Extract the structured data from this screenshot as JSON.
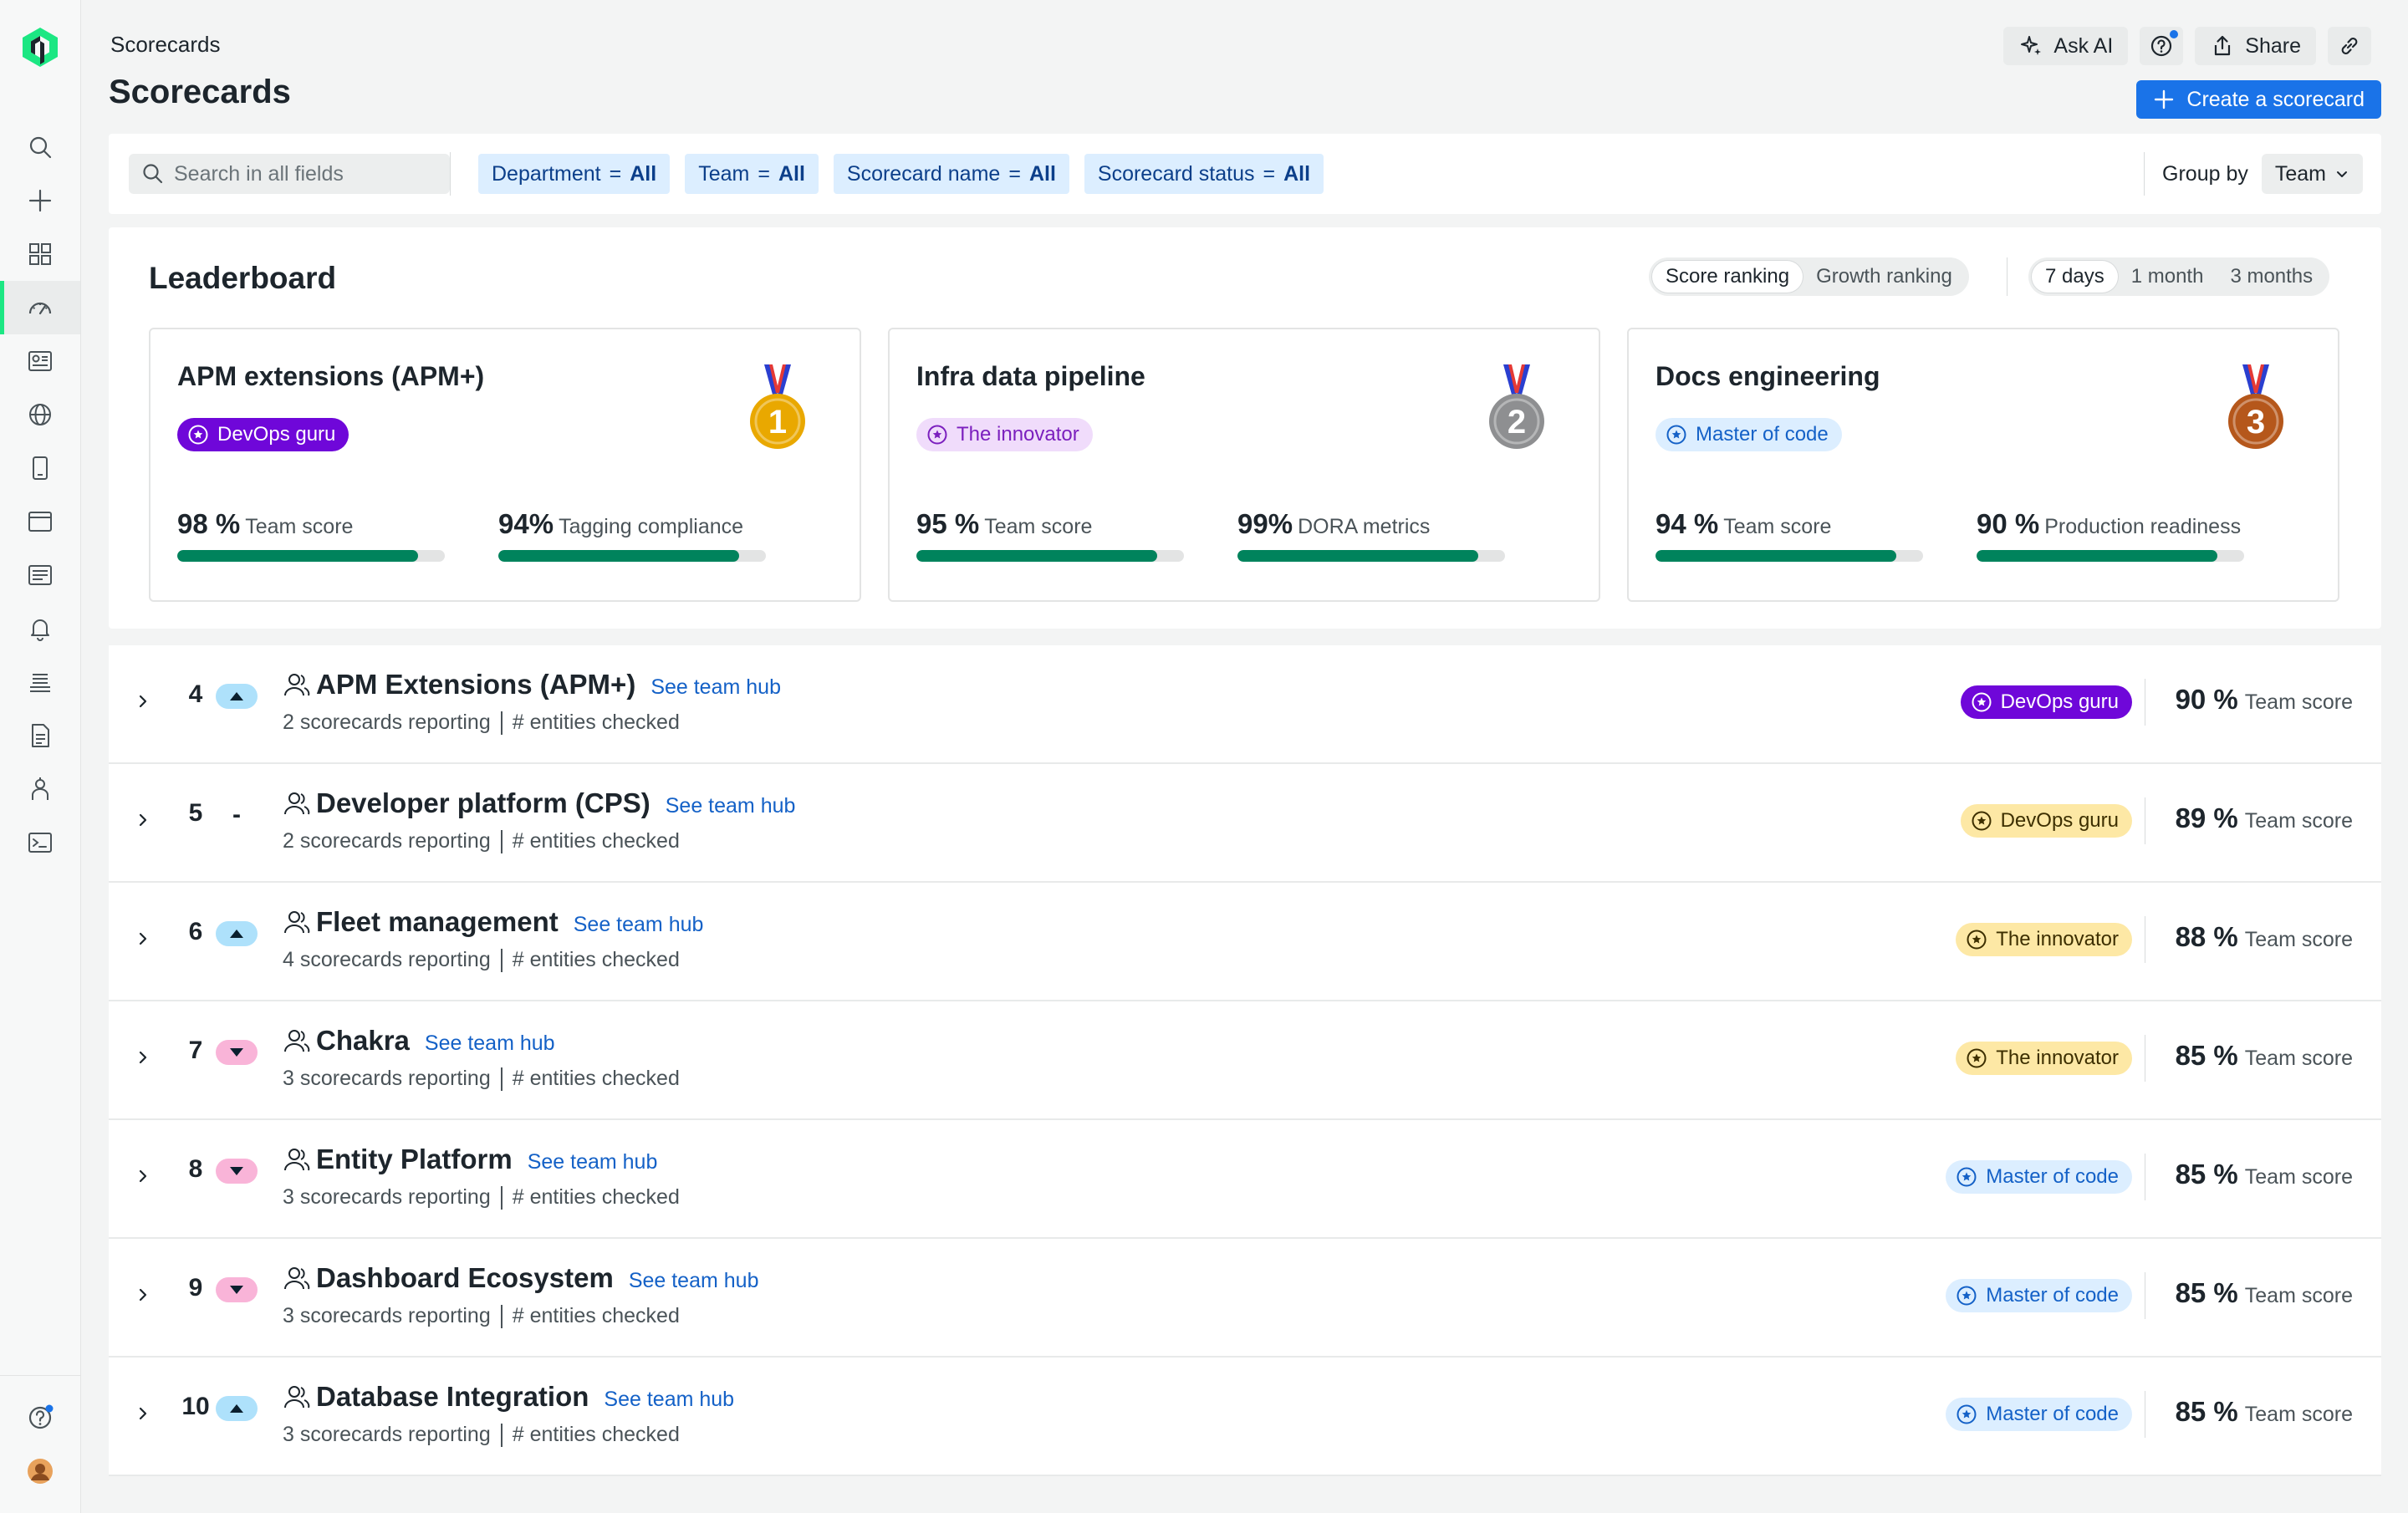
{
  "header": {
    "breadcrumb": "Scorecards",
    "title": "Scorecards",
    "ask_ai": "Ask AI",
    "share": "Share",
    "create": "Create a scorecard"
  },
  "filters": {
    "search_placeholder": "Search in all fields",
    "chips": [
      {
        "key": "Department",
        "op": "=",
        "value": "All"
      },
      {
        "key": "Team",
        "op": "=",
        "value": "All"
      },
      {
        "key": "Scorecard name",
        "op": "=",
        "value": "All"
      },
      {
        "key": "Scorecard status",
        "op": "=",
        "value": "All"
      }
    ],
    "group_by_label": "Group by",
    "group_by_value": "Team"
  },
  "leaderboard": {
    "title": "Leaderboard",
    "ranking_tabs": [
      "Score ranking",
      "Growth ranking"
    ],
    "ranking_selected": "Score ranking",
    "range_tabs": [
      "7 days",
      "1 month",
      "3 months"
    ],
    "range_selected": "7 days",
    "cards": [
      {
        "name": "APM extensions (APM+)",
        "medal": "1",
        "medal_color": "#e9a800",
        "badge": "DevOps guru",
        "badge_style": "purple",
        "metrics": [
          {
            "pct": "98 %",
            "label": "Team score",
            "value": 0.9
          },
          {
            "pct": "94%",
            "label": "Tagging compliance",
            "value": 0.9
          }
        ]
      },
      {
        "name": "Infra data pipeline",
        "medal": "2",
        "medal_color": "#8e8f91",
        "badge": "The innovator",
        "badge_style": "lavender",
        "metrics": [
          {
            "pct": "95 %",
            "label": "Team score",
            "value": 0.9
          },
          {
            "pct": "99%",
            "label": "DORA metrics",
            "value": 0.9
          }
        ]
      },
      {
        "name": "Docs engineering",
        "medal": "3",
        "medal_color": "#b5571b",
        "badge": "Master of code",
        "badge_style": "lightblue",
        "metrics": [
          {
            "pct": "94 %",
            "label": "Team score",
            "value": 0.9
          },
          {
            "pct": "90 %",
            "label": "Production readiness",
            "value": 0.9
          }
        ]
      }
    ]
  },
  "teams": [
    {
      "rank": "4",
      "trend": "up",
      "name": "APM Extensions (APM+)",
      "link": "See team hub",
      "reporting": "2 scorecards reporting",
      "entities": "# entities checked",
      "badge": "DevOps guru",
      "badge_style": "purple",
      "score": "90 %",
      "score_label": "Team score"
    },
    {
      "rank": "5",
      "trend": "flat",
      "trend_text": "-",
      "name": "Developer platform (CPS)",
      "link": "See team hub",
      "reporting": "2 scorecards reporting",
      "entities": "# entities checked",
      "badge": "DevOps guru",
      "badge_style": "yellow",
      "score": "89 %",
      "score_label": "Team score"
    },
    {
      "rank": "6",
      "trend": "up",
      "name": "Fleet management",
      "link": "See team hub",
      "reporting": "4 scorecards reporting",
      "entities": "# entities checked",
      "badge": "The innovator",
      "badge_style": "yellow",
      "score": "88 %",
      "score_label": "Team score"
    },
    {
      "rank": "7",
      "trend": "down",
      "name": "Chakra",
      "link": "See team hub",
      "reporting": "3 scorecards reporting",
      "entities": "# entities checked",
      "badge": "The innovator",
      "badge_style": "yellow",
      "score": "85 %",
      "score_label": "Team score"
    },
    {
      "rank": "8",
      "trend": "down",
      "name": "Entity Platform",
      "link": "See team hub",
      "reporting": "3 scorecards reporting",
      "entities": "# entities checked",
      "badge": "Master of code",
      "badge_style": "lightblue",
      "score": "85 %",
      "score_label": "Team score"
    },
    {
      "rank": "9",
      "trend": "down",
      "name": "Dashboard Ecosystem",
      "link": "See team hub",
      "reporting": "3 scorecards reporting",
      "entities": "# entities checked",
      "badge": "Master of code",
      "badge_style": "lightblue",
      "score": "85 %",
      "score_label": "Team score"
    },
    {
      "rank": "10",
      "trend": "up",
      "name": "Database Integration",
      "link": "See team hub",
      "reporting": "3 scorecards reporting",
      "entities": "# entities checked",
      "badge": "Master of code",
      "badge_style": "lightblue",
      "score": "85 %",
      "score_label": "Team score"
    }
  ],
  "sidebar": {
    "icons": [
      "search-icon",
      "plus-icon",
      "apps-grid-icon",
      "scorecards-gauge-icon",
      "dashboards-icon",
      "globe-icon",
      "mobile-icon",
      "browser-icon",
      "logs-icon",
      "alerts-bell-icon",
      "queries-icon",
      "document-icon",
      "agent-icon",
      "terminal-icon"
    ],
    "active": "scorecards-gauge-icon"
  },
  "colors": {
    "accent": "#1a73e8",
    "progress": "#00835c",
    "logo_green": "#1ce783"
  }
}
